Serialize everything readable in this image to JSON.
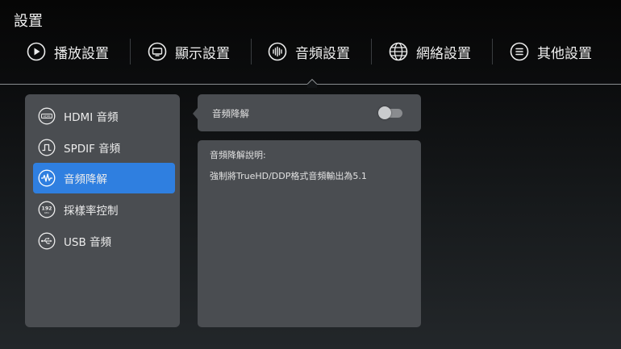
{
  "page": {
    "title": "設置"
  },
  "tabs": [
    {
      "label": "播放設置",
      "icon": "play-icon"
    },
    {
      "label": "顯示設置",
      "icon": "monitor-icon"
    },
    {
      "label": "音頻設置",
      "icon": "audio-waveform-icon",
      "selected": true
    },
    {
      "label": "網絡設置",
      "icon": "globe-icon"
    },
    {
      "label": "其他設置",
      "icon": "menu-lines-icon"
    }
  ],
  "sidebar": {
    "items": [
      {
        "label": "HDMI 音頻",
        "icon": "hdmi-icon"
      },
      {
        "label": "SPDIF 音頻",
        "icon": "spdif-icon"
      },
      {
        "label": "音頻降解",
        "icon": "audio-wave-icon",
        "active": true
      },
      {
        "label": "採樣率控制",
        "icon": "sample-rate-icon",
        "icon_text": "192"
      },
      {
        "label": "USB 音頻",
        "icon": "usb-icon"
      }
    ]
  },
  "setting": {
    "label": "音頻降解",
    "enabled": false
  },
  "description": {
    "title": "音頻降解說明:",
    "text": "強制將TrueHD/DDP格式音頻輸出為5.1"
  },
  "colors": {
    "accent": "#2f7fe0",
    "panel": "#4a4d51"
  }
}
